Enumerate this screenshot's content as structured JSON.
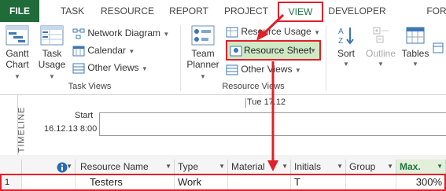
{
  "tabs": [
    {
      "label": "FILE"
    },
    {
      "label": "TASK"
    },
    {
      "label": "RESOURCE"
    },
    {
      "label": "REPORT"
    },
    {
      "label": "PROJECT"
    },
    {
      "label": "VIEW"
    },
    {
      "label": "DEVELOPER"
    },
    {
      "label": "FOR"
    }
  ],
  "ribbon": {
    "gantt_chart": {
      "line1": "Gantt",
      "line2": "Chart"
    },
    "task_usage": {
      "line1": "Task",
      "line2": "Usage"
    },
    "network_diagram": "Network Diagram",
    "calendar": "Calendar",
    "other_views_1": "Other Views",
    "task_views_label": "Task Views",
    "team_planner": {
      "line1": "Team",
      "line2": "Planner"
    },
    "resource_usage": "Resource Usage",
    "resource_sheet": "Resource Sheet",
    "other_views_2": "Other Views",
    "resource_views_label": "Resource Views",
    "sort": "Sort",
    "outline": "Outline",
    "tables": "Tables"
  },
  "timeline": {
    "side_label": "TIMELINE",
    "date_marker": "Tue 17.12",
    "start_label": "Start",
    "start_date": "16.12.13 8:00"
  },
  "grid": {
    "headers": [
      {
        "label": ""
      },
      {
        "label": ""
      },
      {
        "label": "Resource Name"
      },
      {
        "label": "Type"
      },
      {
        "label": "Material"
      },
      {
        "label": "Initials"
      },
      {
        "label": "Group"
      },
      {
        "label": "Max."
      }
    ],
    "rows": [
      {
        "id": "1",
        "indicator": "",
        "name": "Testers",
        "type": "Work",
        "material": "",
        "initials": "T",
        "group": "",
        "max": "300%"
      }
    ]
  },
  "colors": {
    "accent_green": "#217346",
    "highlight_red": "#e0202a",
    "selected_green": "#cfe9c5"
  }
}
